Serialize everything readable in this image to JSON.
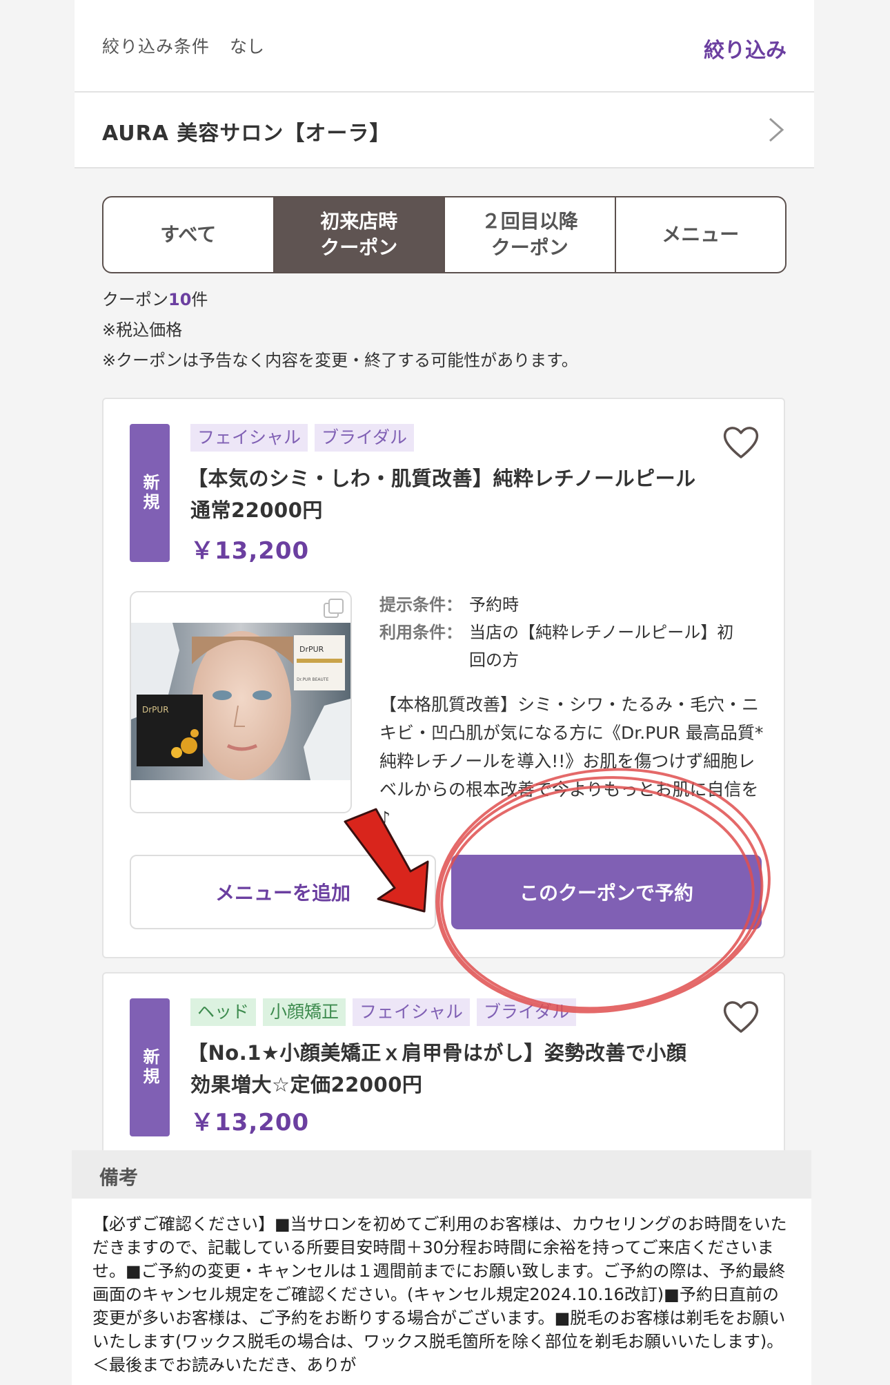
{
  "filter": {
    "label": "絞り込み条件",
    "value": "なし",
    "link": "絞り込み"
  },
  "salon": {
    "name": "AURA 美容サロン【オーラ】"
  },
  "tabs": [
    {
      "label": "すべて"
    },
    {
      "label": "初来店時\nクーポン"
    },
    {
      "label": "２回目以降\nクーポン"
    },
    {
      "label": "メニュー"
    }
  ],
  "info": {
    "count_prefix": "クーポン",
    "count_number": "10",
    "count_suffix": "件",
    "tax_note": "※税込価格",
    "change_note": "※クーポンは予告なく内容を変更・終了する可能性があります。"
  },
  "coupons": [
    {
      "badge": "新規",
      "tags": [
        "フェイシャル",
        "ブライダル"
      ],
      "title_line1": "【本気のシミ・しわ・肌質改善】純粋レチノールピール",
      "title_line2": "通常22000円",
      "price": "￥13,200",
      "image_labels": {
        "brand": "DrPUR",
        "maker": "Dr.PUR BEAUTE"
      },
      "conditions": [
        {
          "key": "提示条件：",
          "value": "予約時"
        },
        {
          "key": "利用条件：",
          "value": "当店の【純粋レチノールピール】初回の方"
        }
      ],
      "description": "【本格肌質改善】シミ・シワ・たるみ・毛穴・ニキビ・凹凸肌が気になる方に《Dr.PUR 最高品質*純粋レチノールを導入!!》お肌を傷つけず細胞レベルからの根本改善で今よりもっとお肌に自信を♪",
      "add_button": "メニューを追加",
      "reserve_button": "このクーポンで予約"
    },
    {
      "badge": "新規",
      "tags": [
        "ヘッド",
        "小顔矯正",
        "フェイシャル",
        "ブライダル"
      ],
      "title_line1": "【No.1★小顔美矯正ｘ肩甲骨はがし】姿勢改善で小顔",
      "title_line2": "効果増大☆定価22000円",
      "price": "￥13,200"
    }
  ],
  "notes": {
    "title": "備考",
    "text": "【必ずご確認ください】■当サロンを初めてご利用のお客様は、カウセリングのお時間をいただきますので、記載している所要目安時間＋30分程お時間に余裕を持ってご来店くださいませ。■ご予約の変更・キャンセルは１週間前までにお願い致します。ご予約の際は、予約最終画面のキャンセル規定をご確認ください。(キャンセル規定2024.10.16改訂)■予約日直前の変更が多いお客様は、ご予約をお断りする場合がございます。■脱毛のお客様は剃毛をお願いいたします(ワックス脱毛の場合は、ワックス脱毛箇所を除く部位を剃毛お願いいたします)。＜最後までお読みいただき、ありが"
  },
  "colors": {
    "accent": "#6b3fa0",
    "badge": "#8060b4",
    "active_tab": "#5f5452",
    "annotation": "#e05050",
    "arrow": "#d9251c"
  }
}
